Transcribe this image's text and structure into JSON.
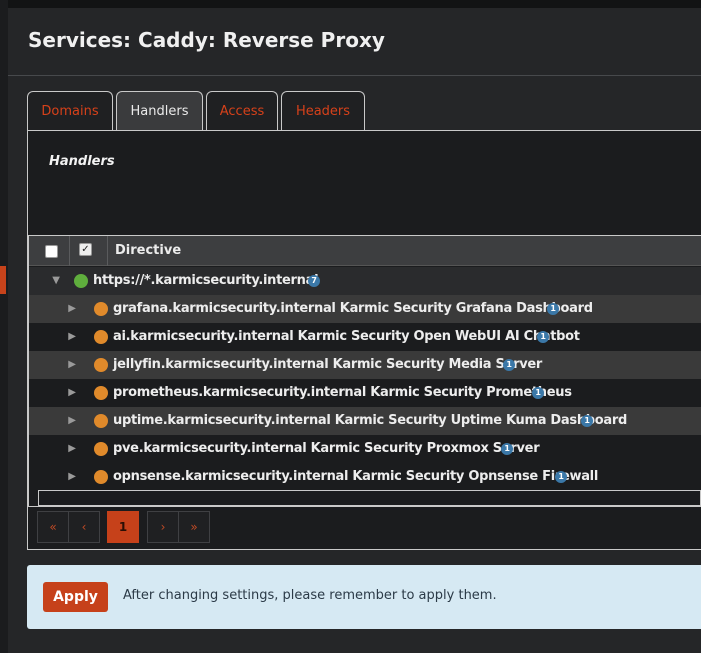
{
  "page": {
    "title": "Services: Caddy: Reverse Proxy"
  },
  "tabs": [
    {
      "label": "Domains",
      "active": false
    },
    {
      "label": "Handlers",
      "active": true
    },
    {
      "label": "Access",
      "active": false
    },
    {
      "label": "Headers",
      "active": false
    }
  ],
  "panel": {
    "title": "Handlers"
  },
  "table": {
    "header": {
      "directive": "Directive",
      "checked_glyph": "✓"
    },
    "root": {
      "label": "https://*.karmicsecurity.internal",
      "count": "7",
      "expanded_glyph": "▼"
    },
    "rows": [
      {
        "label": "grafana.karmicsecurity.internal Karmic Security Grafana Dashboard",
        "count": "1"
      },
      {
        "label": "ai.karmicsecurity.internal Karmic Security Open WebUI AI Chatbot",
        "count": "1"
      },
      {
        "label": "jellyfin.karmicsecurity.internal Karmic Security Media Server",
        "count": "1"
      },
      {
        "label": "prometheus.karmicsecurity.internal Karmic Security Prometheus",
        "count": "1"
      },
      {
        "label": "uptime.karmicsecurity.internal Karmic Security Uptime Kuma Dashboard",
        "count": "1"
      },
      {
        "label": "pve.karmicsecurity.internal Karmic Security Proxmox Server",
        "count": "1"
      },
      {
        "label": "opnsense.karmicsecurity.internal Karmic Security Opnsense Firewall",
        "count": "1"
      }
    ],
    "collapsed_glyph": "▶"
  },
  "pagination": {
    "first": "«",
    "prev": "‹",
    "current": "1",
    "next": "›",
    "last": "»"
  },
  "alert": {
    "button": "Apply",
    "message": "After changing settings, please remember to apply them."
  },
  "colors": {
    "accent": "#c6411a",
    "badge": "#3b78a8",
    "alert_bg": "#d6e9f3",
    "root_globe": "#5fae3d",
    "child_globe": "#e08a2b"
  },
  "icons": {
    "root": "globe-green-icon",
    "child": "globe-orange-icon",
    "badge": "count-badge"
  }
}
